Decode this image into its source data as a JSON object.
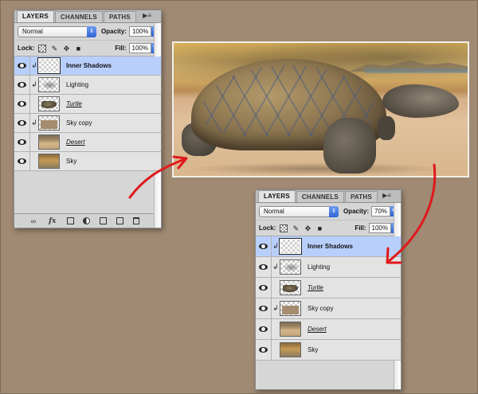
{
  "panel_a": {
    "tabs": [
      "LAYERS",
      "CHANNELS",
      "PATHS"
    ],
    "active_tab": "LAYERS",
    "menu_icon": "panel-menu-icon",
    "blend_mode": "Normal",
    "opacity_label": "Opacity:",
    "opacity_value": "100%",
    "lock_label": "Lock:",
    "fill_label": "Fill:",
    "fill_value": "100%",
    "layers": [
      {
        "name": "Inner Shadows",
        "clipped": true,
        "selected": true,
        "bold": true,
        "underline": false
      },
      {
        "name": "Lighting",
        "clipped": true,
        "selected": false,
        "bold": false,
        "underline": false
      },
      {
        "name": "Turtle",
        "clipped": false,
        "selected": false,
        "bold": false,
        "underline": true
      },
      {
        "name": "Sky copy",
        "clipped": true,
        "selected": false,
        "bold": false,
        "underline": false
      },
      {
        "name": "Desert",
        "clipped": false,
        "selected": false,
        "bold": false,
        "underline": true
      },
      {
        "name": "Sky",
        "clipped": false,
        "selected": false,
        "bold": false,
        "underline": false
      }
    ]
  },
  "panel_b": {
    "tabs": [
      "LAYERS",
      "CHANNELS",
      "PATHS"
    ],
    "active_tab": "LAYERS",
    "menu_icon": "panel-menu-icon",
    "blend_mode": "Normal",
    "opacity_label": "Opacity:",
    "opacity_value": "70%",
    "lock_label": "Lock:",
    "fill_label": "Fill:",
    "fill_value": "100%",
    "layers": [
      {
        "name": "Inner Shadows",
        "clipped": true,
        "selected": true,
        "bold": true,
        "underline": false
      },
      {
        "name": "Lighting",
        "clipped": true,
        "selected": false,
        "bold": false,
        "underline": false
      },
      {
        "name": "Turtle",
        "clipped": false,
        "selected": false,
        "bold": false,
        "underline": true
      },
      {
        "name": "Sky copy",
        "clipped": true,
        "selected": false,
        "bold": false,
        "underline": false
      },
      {
        "name": "Desert",
        "clipped": false,
        "selected": false,
        "bold": false,
        "underline": true
      },
      {
        "name": "Sky",
        "clipped": false,
        "selected": false,
        "bold": false,
        "underline": false
      }
    ]
  },
  "colors": {
    "background": "#a08a73",
    "panel": "#d6d6d6",
    "selected_row": "#b9cffb",
    "arrow": "#e0191b"
  }
}
